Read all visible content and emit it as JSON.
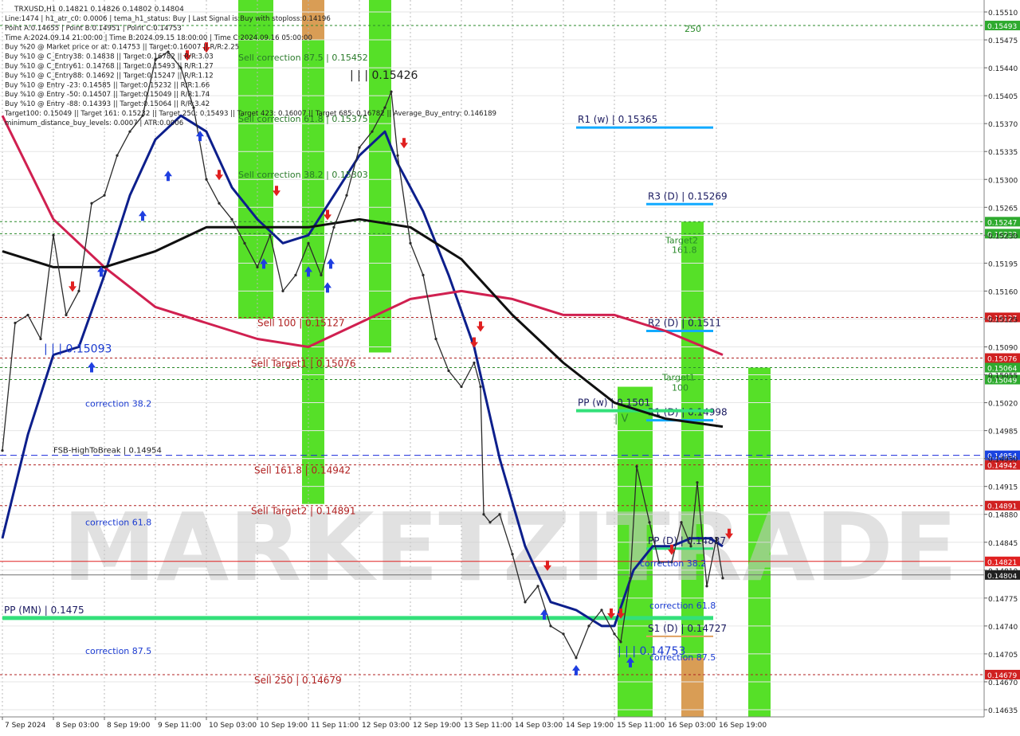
{
  "chart_data": {
    "type": "line",
    "title": "TRXUSD,H1  0.14821 0.14826 0.14802 0.14804",
    "info_lines": [
      "Line:1474 | h1_atr_c0: 0.0006 | tema_h1_status: Buy | Last Signal is:Buy with stoploss:0.14196",
      "Point A:0.14655 | Point B:0.14951 | Point C:0.14753",
      "Time A:2024.09.14 21:00:00 | Time B:2024.09.15 18:00:00 | Time C:2024.09.16 05:00:00",
      "Buy %20 @ Market price or at: 0.14753 || Target:0.16007 || R/R:2.25",
      "Buy %10 @ C_Entry38: 0.14838 || Target:0.16782 || R/R:3.03",
      "Buy %10 @ C_Entry61: 0.14768 || Target:0.15493 || R/R:1.27",
      "Buy %10 @ C_Entry88: 0.14692 || Target:0.15247 || R/R:1.12",
      "Buy %10 @ Entry -23: 0.14585 || Target:0.15232 || R/R:1.66",
      "Buy %10 @ Entry -50: 0.14507 || Target:0.15049 || R/R:1.74",
      "Buy %10 @ Entry -88: 0.14393 || Target:0.15064 || R/R:3.42",
      "Target100: 0.15049 || Target 161: 0.15232 || Target 250: 0.15493 || Target 423: 0.16007 || Target 685: 0.16782 || Average_Buy_entry: 0.146189",
      "minimum_distance_buy_levels: 0.0007 | ATR:0.0006"
    ],
    "watermark": "MARKETZITRADE",
    "ylim": [
      0.14626,
      0.15525
    ],
    "y_ticks": [
      0.1551,
      0.15475,
      0.1544,
      0.15405,
      0.1537,
      0.15335,
      0.153,
      0.15265,
      0.1523,
      0.15195,
      0.1516,
      0.15125,
      0.1509,
      0.15055,
      0.1502,
      0.14985,
      0.1495,
      0.14915,
      0.1488,
      0.14845,
      0.1481,
      0.14775,
      0.1474,
      0.14705,
      0.1467,
      0.14635
    ],
    "y_tick_labels": [
      "0.15510",
      "0.15475",
      "0.15440",
      "0.15405",
      "0.15370",
      "0.15335",
      "0.15300",
      "0.15265",
      "0.15230",
      "0.15195",
      "0.15160",
      "0.15125",
      "0.15090",
      "0.15055",
      "0.15020",
      "0.14985",
      "0.14950",
      "0.14915",
      "0.14880",
      "0.14845",
      "0.14810",
      "0.14775",
      "0.14740",
      "0.14705",
      "0.14670",
      "0.14635"
    ],
    "x_range": [
      0,
      240
    ],
    "x_ticks": [
      {
        "x": 0,
        "label": "7 Sep 2024"
      },
      {
        "x": 16,
        "label": "8 Sep 03:00"
      },
      {
        "x": 32,
        "label": "8 Sep 19:00"
      },
      {
        "x": 48,
        "label": "9 Sep 11:00"
      },
      {
        "x": 64,
        "label": "10 Sep 03:00"
      },
      {
        "x": 80,
        "label": "10 Sep 19:00"
      },
      {
        "x": 96,
        "label": "11 Sep 11:00"
      },
      {
        "x": 112,
        "label": "12 Sep 03:00"
      },
      {
        "x": 128,
        "label": "12 Sep 19:00"
      },
      {
        "x": 144,
        "label": "13 Sep 11:00"
      },
      {
        "x": 160,
        "label": "14 Sep 03:00"
      },
      {
        "x": 176,
        "label": "14 Sep 19:00"
      },
      {
        "x": 192,
        "label": "15 Sep 11:00"
      },
      {
        "x": 208,
        "label": "16 Sep 03:00"
      },
      {
        "x": 224,
        "label": "16 Sep 19:00"
      }
    ],
    "price_series": [
      [
        0,
        0.1496
      ],
      [
        4,
        0.1512
      ],
      [
        8,
        0.1513
      ],
      [
        12,
        0.151
      ],
      [
        16,
        0.1523
      ],
      [
        20,
        0.1513
      ],
      [
        24,
        0.1516
      ],
      [
        28,
        0.1527
      ],
      [
        32,
        0.1528
      ],
      [
        36,
        0.1533
      ],
      [
        40,
        0.1536
      ],
      [
        44,
        0.1538
      ],
      [
        48,
        0.1545
      ],
      [
        52,
        0.1546
      ],
      [
        56,
        0.1544
      ],
      [
        60,
        0.1539
      ],
      [
        64,
        0.153
      ],
      [
        68,
        0.1527
      ],
      [
        72,
        0.1525
      ],
      [
        76,
        0.1522
      ],
      [
        80,
        0.1519
      ],
      [
        84,
        0.1523
      ],
      [
        88,
        0.1516
      ],
      [
        92,
        0.1518
      ],
      [
        96,
        0.1522
      ],
      [
        100,
        0.1518
      ],
      [
        104,
        0.1524
      ],
      [
        108,
        0.1528
      ],
      [
        112,
        0.1534
      ],
      [
        116,
        0.1536
      ],
      [
        120,
        0.1539
      ],
      [
        122,
        0.1541
      ],
      [
        124,
        0.1533
      ],
      [
        128,
        0.1522
      ],
      [
        132,
        0.1518
      ],
      [
        136,
        0.151
      ],
      [
        140,
        0.1506
      ],
      [
        144,
        0.1504
      ],
      [
        148,
        0.1507
      ],
      [
        150,
        0.1504
      ],
      [
        151,
        0.1488
      ],
      [
        153,
        0.1487
      ],
      [
        156,
        0.1488
      ],
      [
        160,
        0.1483
      ],
      [
        164,
        0.1477
      ],
      [
        168,
        0.1479
      ],
      [
        172,
        0.1474
      ],
      [
        176,
        0.1473
      ],
      [
        180,
        0.147
      ],
      [
        184,
        0.1474
      ],
      [
        188,
        0.1476
      ],
      [
        192,
        0.1473
      ],
      [
        194,
        0.1472
      ],
      [
        197,
        0.148
      ],
      [
        199,
        0.1494
      ],
      [
        203,
        0.1487
      ],
      [
        206,
        0.1482
      ],
      [
        210,
        0.1482
      ],
      [
        213,
        0.1487
      ],
      [
        216,
        0.1484
      ],
      [
        218,
        0.1492
      ],
      [
        221,
        0.1479
      ],
      [
        224,
        0.1485
      ],
      [
        226,
        0.148
      ]
    ],
    "series": [
      {
        "color": "#0d1f8c",
        "values": [
          [
            0,
            0.1485
          ],
          [
            8,
            0.1498
          ],
          [
            16,
            0.1508
          ],
          [
            24,
            0.1509
          ],
          [
            32,
            0.1518
          ],
          [
            40,
            0.1528
          ],
          [
            48,
            0.1535
          ],
          [
            56,
            0.1538
          ],
          [
            64,
            0.1536
          ],
          [
            72,
            0.1529
          ],
          [
            80,
            0.1525
          ],
          [
            88,
            0.1522
          ],
          [
            96,
            0.1523
          ],
          [
            104,
            0.1528
          ],
          [
            112,
            0.1533
          ],
          [
            120,
            0.1536
          ],
          [
            124,
            0.1532
          ],
          [
            132,
            0.1526
          ],
          [
            140,
            0.1518
          ],
          [
            148,
            0.1509
          ],
          [
            156,
            0.1495
          ],
          [
            164,
            0.1484
          ],
          [
            172,
            0.1477
          ],
          [
            180,
            0.1476
          ],
          [
            188,
            0.1474
          ],
          [
            192,
            0.1474
          ],
          [
            198,
            0.1481
          ],
          [
            204,
            0.1484
          ],
          [
            210,
            0.1484
          ],
          [
            216,
            0.1485
          ],
          [
            222,
            0.1485
          ],
          [
            226,
            0.1484
          ]
        ]
      },
      {
        "color": "#d02050",
        "values": [
          [
            0,
            0.1538
          ],
          [
            16,
            0.1525
          ],
          [
            32,
            0.1519
          ],
          [
            48,
            0.1514
          ],
          [
            64,
            0.1512
          ],
          [
            80,
            0.151
          ],
          [
            96,
            0.1509
          ],
          [
            112,
            0.1512
          ],
          [
            128,
            0.1515
          ],
          [
            144,
            0.1516
          ],
          [
            160,
            0.1515
          ],
          [
            176,
            0.1513
          ],
          [
            192,
            0.1513
          ],
          [
            208,
            0.1511
          ],
          [
            226,
            0.1508
          ]
        ]
      },
      {
        "color": "#101010",
        "values": [
          [
            0,
            0.1521
          ],
          [
            16,
            0.1519
          ],
          [
            32,
            0.1519
          ],
          [
            48,
            0.1521
          ],
          [
            64,
            0.1524
          ],
          [
            80,
            0.1524
          ],
          [
            96,
            0.1524
          ],
          [
            112,
            0.1525
          ],
          [
            128,
            0.1524
          ],
          [
            144,
            0.152
          ],
          [
            160,
            0.1513
          ],
          [
            176,
            0.1507
          ],
          [
            192,
            0.1502
          ],
          [
            208,
            0.15
          ],
          [
            226,
            0.1499
          ]
        ]
      }
    ],
    "green_zones": [
      {
        "x0": 74,
        "x1": 85,
        "y0": 0.15125,
        "y1": 0.15525
      },
      {
        "x0": 94,
        "x1": 101,
        "y0": 0.14893,
        "y1": 0.15525
      },
      {
        "x0": 115,
        "x1": 122,
        "y0": 0.15083,
        "y1": 0.15525
      },
      {
        "x0": 193,
        "x1": 204,
        "y0": 0.14626,
        "y1": 0.1504
      },
      {
        "x0": 213,
        "x1": 220,
        "y0": 0.14626,
        "y1": 0.15247
      },
      {
        "x0": 234,
        "x1": 241,
        "y0": 0.14626,
        "y1": 0.15064
      }
    ],
    "orange_zones": [
      {
        "x0": 94,
        "x1": 101,
        "y0": 0.15475,
        "y1": 0.15525
      },
      {
        "x0": 213,
        "x1": 220,
        "y0": 0.14626,
        "y1": 0.147
      }
    ],
    "h_levels": [
      {
        "y": 0.15493,
        "label": "0.15493",
        "color": "#2a8a2a",
        "style": "dash",
        "box": "#2eaa2e"
      },
      {
        "y": 0.15247,
        "label": "0.15247",
        "color": "#2a8a2a",
        "style": "dash",
        "box": "#2eaa2e"
      },
      {
        "y": 0.15232,
        "label": "0.15232",
        "color": "#2a8a2a",
        "style": "dash",
        "box": "#2eaa2e"
      },
      {
        "y": 0.15127,
        "label": "0.15127",
        "color": "#b02020",
        "style": "dash",
        "box": "#d02020"
      },
      {
        "y": 0.15076,
        "label": "0.15076",
        "color": "#b02020",
        "style": "dash",
        "box": "#d02020"
      },
      {
        "y": 0.15064,
        "label": "0.15064",
        "color": "#2a8a2a",
        "style": "dash",
        "box": "#2eaa2e"
      },
      {
        "y": 0.15049,
        "label": "0.15049",
        "color": "#2a8a2a",
        "style": "dash",
        "box": "#2eaa2e"
      },
      {
        "y": 0.14954,
        "label": "0.14954",
        "color": "#1a2adc",
        "style": "longdash",
        "box": "#1a44e0"
      },
      {
        "y": 0.14942,
        "label": "0.14942",
        "color": "#b02020",
        "style": "dash",
        "box": "#d02020"
      },
      {
        "y": 0.14891,
        "label": "0.14891",
        "color": "#b02020",
        "style": "dash",
        "box": "#d02020"
      },
      {
        "y": 0.14821,
        "label": "0.14821",
        "color": "#e02020",
        "style": "solid",
        "box": "#e02020"
      },
      {
        "y": 0.14804,
        "label": "0.14804",
        "color": "#707070",
        "style": "solid",
        "box": "#202020"
      },
      {
        "y": 0.14679,
        "label": "0.14679",
        "color": "#b02020",
        "style": "dash",
        "box": "#d02020"
      }
    ],
    "pivot_lines": [
      {
        "y": 0.15365,
        "x0": 180,
        "x1": 223,
        "label": "R1 (w) | 0.15365",
        "color": "#11aaff",
        "lx": 180
      },
      {
        "y": 0.15269,
        "x0": 202,
        "x1": 223,
        "label": "R3 (D) | 0.15269",
        "color": "#11aaff",
        "lx": 202
      },
      {
        "y": 0.1511,
        "x0": 202,
        "x1": 223,
        "label": "R2 (D) | 0.1511",
        "color": "#11aaff",
        "lx": 202
      },
      {
        "y": 0.14998,
        "x0": 202,
        "x1": 223,
        "label": "R1 (D) | 0.14998",
        "color": "#11aaff",
        "lx": 202
      },
      {
        "y": 0.1501,
        "x0": 180,
        "x1": 223,
        "label": "PP (w) | 0.1501",
        "color": "#33e07a",
        "lx": 180,
        "w": 4
      },
      {
        "y": 0.14837,
        "x0": 202,
        "x1": 223,
        "label": "PP (D) | 0.14837",
        "color": "#33e07a",
        "lx": 202,
        "w": 3
      },
      {
        "y": 0.14727,
        "x0": 202,
        "x1": 223,
        "label": "S1 (D) | 0.14727",
        "color": "#e0a060",
        "lx": 202,
        "w": 2
      },
      {
        "y": 0.1475,
        "x0": 0,
        "x1": 223,
        "label": "PP (MN) | 0.1475",
        "color": "#33e07a",
        "lx": 0,
        "w": 5
      }
    ],
    "annotations": [
      {
        "x": 109,
        "y": 0.15426,
        "text": "| | | 0.15426",
        "color": "#202020",
        "size": 14
      },
      {
        "x": 214,
        "y": 0.15485,
        "text": "250",
        "color": "#2a8a2a",
        "size": 11
      },
      {
        "x": 74,
        "y": 0.15449,
        "text": "Sell correction 87.5 | 0.15452",
        "color": "#2a7a2a",
        "size": 11
      },
      {
        "x": 74,
        "y": 0.15372,
        "text": "Sell correction 61.8 | 0.15375",
        "color": "#2a7a2a",
        "size": 11
      },
      {
        "x": 74,
        "y": 0.15302,
        "text": "Sell correction 38.2 | 0.15303",
        "color": "#2a7a2a",
        "size": 11
      },
      {
        "x": 80,
        "y": 0.15116,
        "text": "Sell 100 | 0.15127",
        "color": "#b02020",
        "size": 12
      },
      {
        "x": 78,
        "y": 0.15065,
        "text": "Sell Target1 | 0.15076",
        "color": "#b02020",
        "size": 12
      },
      {
        "x": 79,
        "y": 0.14931,
        "text": "Sell 161.8 | 0.14942",
        "color": "#b02020",
        "size": 12
      },
      {
        "x": 78,
        "y": 0.1488,
        "text": "Sell Target2 | 0.14891",
        "color": "#b02020",
        "size": 12
      },
      {
        "x": 79,
        "y": 0.14668,
        "text": "Sell  250 | 0.14679",
        "color": "#b02020",
        "size": 12
      },
      {
        "x": 13,
        "y": 0.15083,
        "text": "| | | 0.15093",
        "color": "#1a3ad0",
        "size": 14
      },
      {
        "x": 26,
        "y": 0.15015,
        "text": "correction 38.2",
        "color": "#1a3ad0",
        "size": 11
      },
      {
        "x": 26,
        "y": 0.14866,
        "text": "correction 61.8",
        "color": "#1a3ad0",
        "size": 11
      },
      {
        "x": 26,
        "y": 0.14705,
        "text": "correction 87.5",
        "color": "#1a3ad0",
        "size": 11
      },
      {
        "x": 16,
        "y": 0.14957,
        "text": "FSB-HighToBreak  | 0.14954",
        "color": "#202020",
        "size": 10
      },
      {
        "x": 208,
        "y": 0.1522,
        "text": "Target2",
        "color": "#2a8a2a",
        "size": 11
      },
      {
        "x": 210,
        "y": 0.15208,
        "text": "161.8",
        "color": "#2a8a2a",
        "size": 11
      },
      {
        "x": 207,
        "y": 0.15048,
        "text": "Target1",
        "color": "#2a8a2a",
        "size": 11
      },
      {
        "x": 210,
        "y": 0.15035,
        "text": "100",
        "color": "#2a8a2a",
        "size": 11
      },
      {
        "x": 200,
        "y": 0.14815,
        "text": "correction 38.2",
        "color": "#1a3ad0",
        "size": 11
      },
      {
        "x": 203,
        "y": 0.14762,
        "text": "correction 61.8",
        "color": "#1a3ad0",
        "size": 11
      },
      {
        "x": 203,
        "y": 0.14697,
        "text": "correction 87.5",
        "color": "#1a3ad0",
        "size": 11
      },
      {
        "x": 193,
        "y": 0.14704,
        "text": "| | | 0.14753",
        "color": "#1a3ad0",
        "size": 14
      },
      {
        "x": 192,
        "y": 0.14996,
        "text": "| V",
        "color": "#2a8a2a",
        "size": 13
      }
    ],
    "buy_arrows": [
      [
        28,
        0.1508
      ],
      [
        31,
        0.152
      ],
      [
        44,
        0.1527
      ],
      [
        52,
        0.1532
      ],
      [
        62,
        0.1537
      ],
      [
        82,
        0.1521
      ],
      [
        96,
        0.152
      ],
      [
        102,
        0.1518
      ],
      [
        103,
        0.1521
      ],
      [
        170,
        0.1477
      ],
      [
        180,
        0.147
      ],
      [
        197,
        0.1471
      ]
    ],
    "sell_arrows": [
      [
        22,
        0.1515
      ],
      [
        58,
        0.1544
      ],
      [
        64,
        0.1545
      ],
      [
        68,
        0.1529
      ],
      [
        86,
        0.1527
      ],
      [
        102,
        0.1524
      ],
      [
        126,
        0.1533
      ],
      [
        148,
        0.1508
      ],
      [
        150,
        0.151
      ],
      [
        171,
        0.148
      ],
      [
        191,
        0.1474
      ],
      [
        194,
        0.1474
      ],
      [
        210,
        0.1482
      ],
      [
        228,
        0.1484
      ]
    ]
  }
}
